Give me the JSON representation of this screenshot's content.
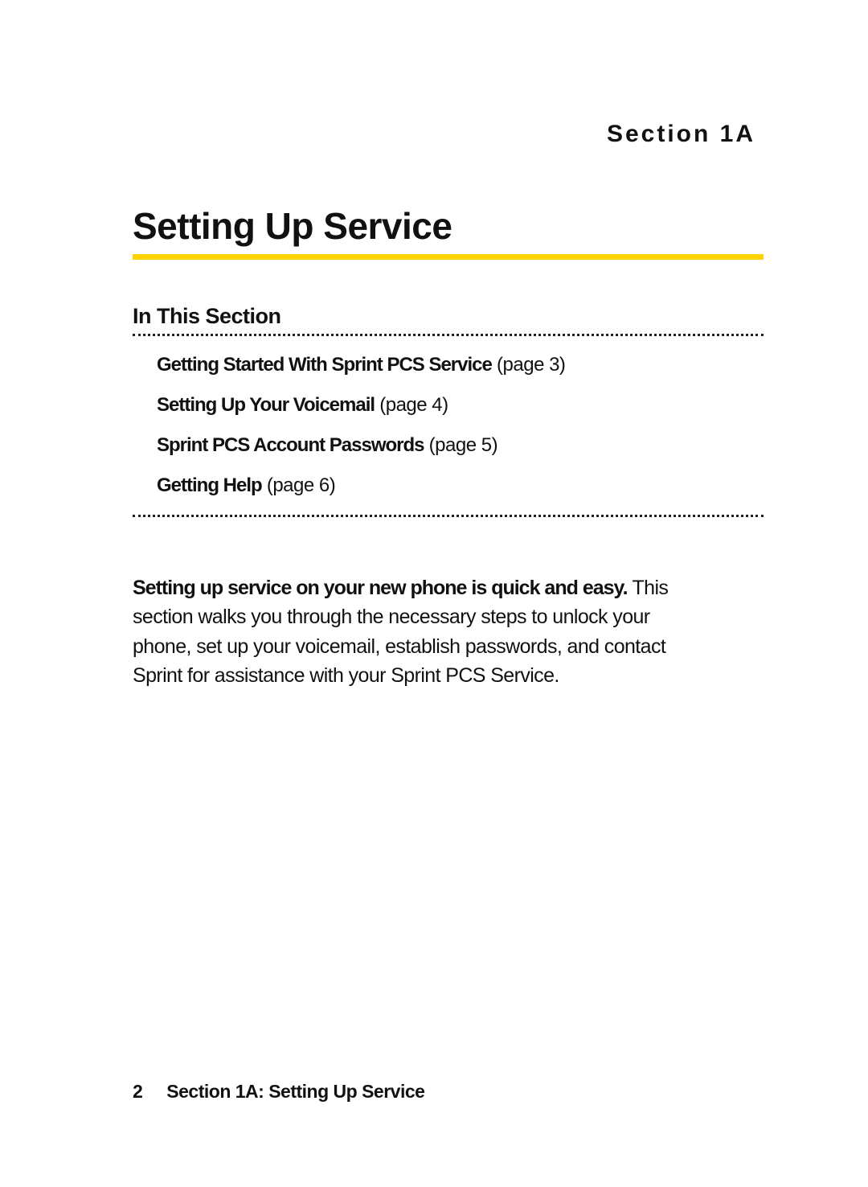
{
  "section_label": "Section 1A",
  "title": "Setting Up Service",
  "subhead": "In This Section",
  "toc": [
    {
      "title": "Getting Started With Sprint PCS Service",
      "page_ref": " (page 3)"
    },
    {
      "title": "Setting Up Your Voicemail",
      "page_ref": " (page 4)"
    },
    {
      "title": "Sprint PCS Account Passwords",
      "page_ref": " (page 5)"
    },
    {
      "title": "Getting Help",
      "page_ref": " (page 6)"
    }
  ],
  "body": {
    "lead": "Setting up service on your new phone is quick and easy. ",
    "rest": "This section walks you through the necessary steps to unlock your phone, set up your voicemail, establish passwords, and contact Sprint for assistance with your Sprint PCS Service."
  },
  "footer": {
    "page_number": "2",
    "text": "Section 1A: Setting Up Service"
  }
}
